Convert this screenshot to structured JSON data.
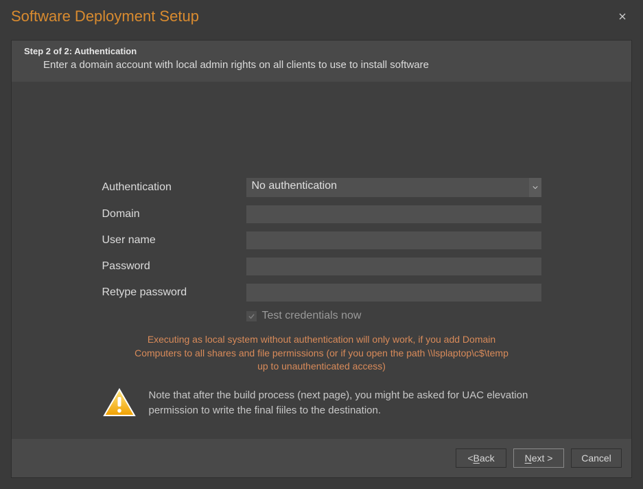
{
  "window": {
    "title": "Software Deployment Setup"
  },
  "step": {
    "line1": "Step 2 of 2: Authentication",
    "line2": "Enter a domain account with local admin rights on all clients to use to install software"
  },
  "form": {
    "auth_label": "Authentication",
    "auth_selected": "No authentication",
    "domain_label": "Domain",
    "domain_value": "",
    "username_label": "User name",
    "username_value": "",
    "password_label": "Password",
    "password_value": "",
    "retype_label": "Retype password",
    "retype_value": "",
    "test_credentials_label": "Test credentials now",
    "test_credentials_checked": true
  },
  "warning": "Executing as local system without authentication will only work, if you add Domain Computers to all shares and file permissions (or if you open the path \\\\lsplaptop\\c$\\temp up to unauthenticated access)",
  "note": "Note that after the build process (next page), you might be asked for UAC elevation permission to write the final fiiles to the destination.",
  "footer": {
    "back_prefix": "< ",
    "back_u": "B",
    "back_rest": "ack",
    "next_u": "N",
    "next_rest": "ext >",
    "cancel": "Cancel"
  }
}
